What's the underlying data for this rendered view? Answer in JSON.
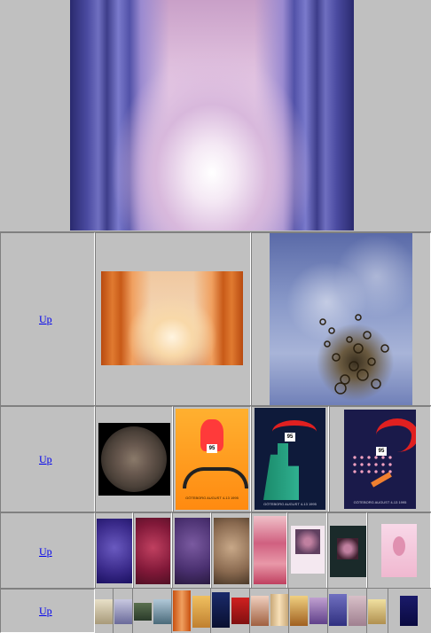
{
  "rows": [
    {
      "up_label": ""
    },
    {
      "up_label": "Up"
    },
    {
      "up_label": "Up"
    },
    {
      "up_label": "Up"
    },
    {
      "up_label": "Up"
    }
  ],
  "poster_texts": {
    "poster_a": "GÖTEBORG AUGUST 4-13 1995",
    "poster_b": "GÖTEBORG AUGUST 4-13 1995",
    "poster_c": "GÖTEBORG AUGUST 4-13 1995",
    "badge": "95"
  },
  "icons": [
    "hero-artwork",
    "thumbnail-artwork"
  ]
}
